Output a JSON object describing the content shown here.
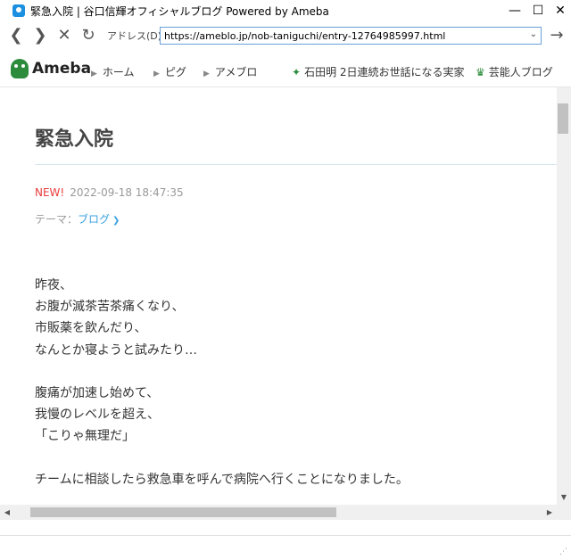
{
  "window": {
    "title": "緊急入院 | 谷口信輝オフィシャルブログ Powered by Ameba",
    "minimize": "—",
    "maximize": "☐",
    "close": "✕"
  },
  "toolbar": {
    "back": "❮",
    "forward": "❯",
    "stop": "✕",
    "refresh": "↻",
    "address_label": "アドレス(D)",
    "url": "https://ameblo.jp/nob-taniguchi/entry-12764985997.html",
    "dropdown": "⌄",
    "go": "→"
  },
  "header": {
    "logo_text": "Ameba",
    "nav": [
      {
        "label": "ホーム"
      },
      {
        "label": "ピグ"
      },
      {
        "label": "アメブロ"
      }
    ],
    "featured": "石田明 2日連続お世話になる実家",
    "celeb": "芸能人ブログ"
  },
  "entry": {
    "title": "緊急入院",
    "new_badge": "NEW!",
    "datetime": "2022-09-18 18:47:35",
    "theme_label": "テーマ：",
    "theme_link": "ブログ",
    "lines": [
      "昨夜、",
      "お腹が滅茶苦茶痛くなり、",
      "市販薬を飲んだり、",
      "なんとか寝ようと試みたり…",
      "",
      "腹痛が加速し始めて、",
      "我慢のレベルを超え、",
      "「こりゃ無理だ」",
      "",
      "チームに相談したら救急車を呼んで病院へ行くことになりました。"
    ]
  },
  "colors": {
    "brand_green": "#2d8c3c",
    "new_red": "#e83b3b",
    "link_blue": "#3aa0e0"
  }
}
